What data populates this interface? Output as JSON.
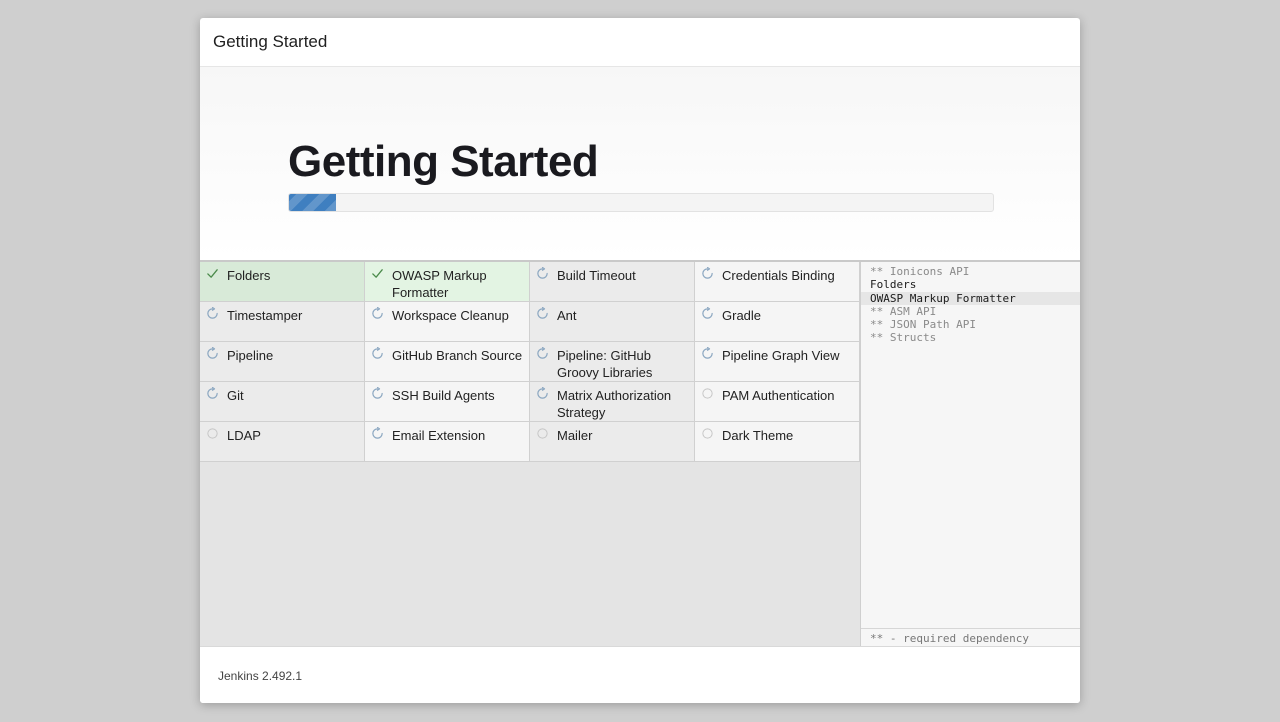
{
  "dialog": {
    "header_title": "Getting Started",
    "hero_title": "Getting Started",
    "progress": 0.067
  },
  "colors": {
    "progress_fill": "#3f7fc0",
    "success_check": "#4a8a4a",
    "spinner": "#8aa6c0",
    "pending_circle": "#c4c4c4"
  },
  "plugins": [
    {
      "name": "Folders",
      "status": "success"
    },
    {
      "name": "OWASP Markup Formatter",
      "status": "success"
    },
    {
      "name": "Build Timeout",
      "status": "installing"
    },
    {
      "name": "Credentials Binding",
      "status": "installing"
    },
    {
      "name": "Timestamper",
      "status": "installing"
    },
    {
      "name": "Workspace Cleanup",
      "status": "installing"
    },
    {
      "name": "Ant",
      "status": "installing"
    },
    {
      "name": "Gradle",
      "status": "installing"
    },
    {
      "name": "Pipeline",
      "status": "installing"
    },
    {
      "name": "GitHub Branch Source",
      "status": "installing"
    },
    {
      "name": "Pipeline: GitHub Groovy Libraries",
      "status": "installing"
    },
    {
      "name": "Pipeline Graph View",
      "status": "installing"
    },
    {
      "name": "Git",
      "status": "installing"
    },
    {
      "name": "SSH Build Agents",
      "status": "installing"
    },
    {
      "name": "Matrix Authorization Strategy",
      "status": "installing"
    },
    {
      "name": "PAM Authentication",
      "status": "pending"
    },
    {
      "name": "LDAP",
      "status": "pending"
    },
    {
      "name": "Email Extension",
      "status": "installing"
    },
    {
      "name": "Mailer",
      "status": "pending"
    },
    {
      "name": "Dark Theme",
      "status": "pending"
    }
  ],
  "dependency_log": {
    "lines": [
      {
        "text": "** Ionicons API",
        "kind": "dependency"
      },
      {
        "text": "Folders",
        "kind": "plugin"
      },
      {
        "text": "OWASP Markup Formatter",
        "kind": "current"
      },
      {
        "text": "** ASM API",
        "kind": "dependency"
      },
      {
        "text": "** JSON Path API",
        "kind": "dependency"
      },
      {
        "text": "** Structs",
        "kind": "dependency"
      }
    ],
    "footer": "** - required dependency"
  },
  "footer": {
    "version": "Jenkins 2.492.1"
  }
}
